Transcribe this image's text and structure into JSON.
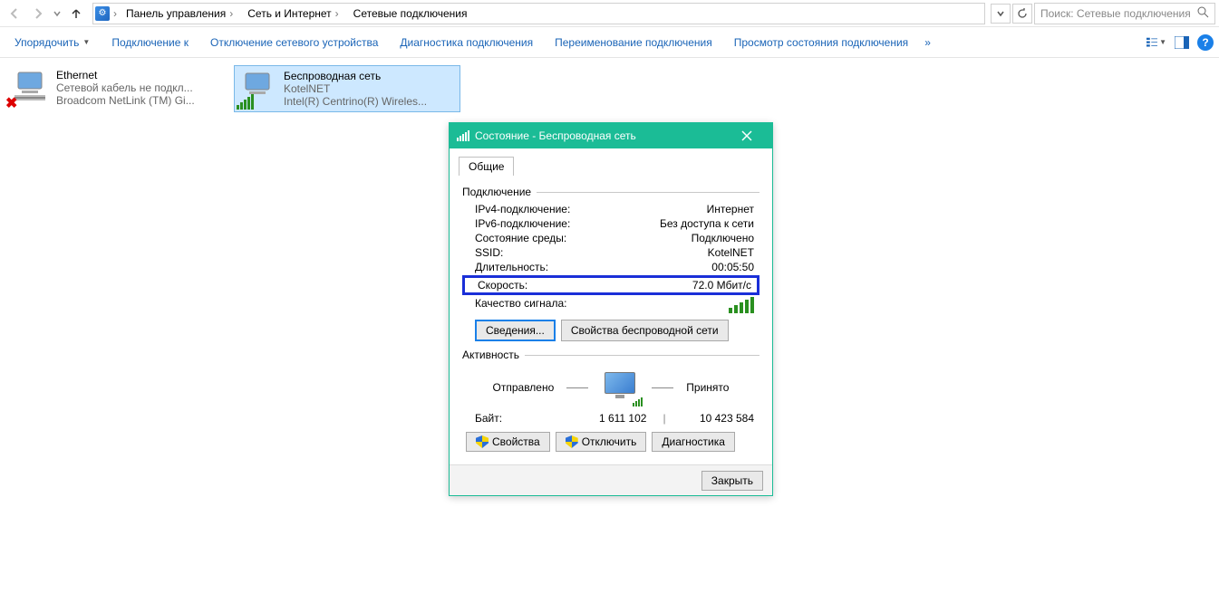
{
  "breadcrumbs": {
    "seg1": "Панель управления",
    "seg2": "Сеть и Интернет",
    "seg3": "Сетевые подключения"
  },
  "search_placeholder": "Поиск: Сетевые подключения",
  "toolbar": {
    "organize": "Упорядочить",
    "connect": "Подключение к",
    "disable": "Отключение сетевого устройства",
    "diagnose": "Диагностика подключения",
    "rename": "Переименование подключения",
    "status": "Просмотр состояния подключения"
  },
  "adapters": [
    {
      "name": "Ethernet",
      "line2": "Сетевой кабель не подкл...",
      "line3": "Broadcom NetLink (TM) Gi..."
    },
    {
      "name": "Беспроводная сеть",
      "line2": "KotelNET",
      "line3": "Intel(R) Centrino(R) Wireles..."
    }
  ],
  "dialog": {
    "title": "Состояние - Беспроводная сеть",
    "tab_general": "Общие",
    "group_connection": "Подключение",
    "rows": {
      "ipv4_k": "IPv4-подключение:",
      "ipv4_v": "Интернет",
      "ipv6_k": "IPv6-подключение:",
      "ipv6_v": "Без доступа к сети",
      "media_k": "Состояние среды:",
      "media_v": "Подключено",
      "ssid_k": "SSID:",
      "ssid_v": "KotelNET",
      "dur_k": "Длительность:",
      "dur_v": "00:05:50",
      "speed_k": "Скорость:",
      "speed_v": "72.0 Мбит/с",
      "sig_k": "Качество сигнала:"
    },
    "details_btn": "Сведения...",
    "wifi_props_btn": "Свойства беспроводной сети",
    "group_activity": "Активность",
    "activity": {
      "sent": "Отправлено",
      "recv": "Принято",
      "bytes_k": "Байт:",
      "bytes_sent": "1 611 102",
      "bytes_recv": "10 423 584"
    },
    "props_btn": "Свойства",
    "disable_btn": "Отключить",
    "diag_btn": "Диагностика",
    "close_btn": "Закрыть"
  }
}
